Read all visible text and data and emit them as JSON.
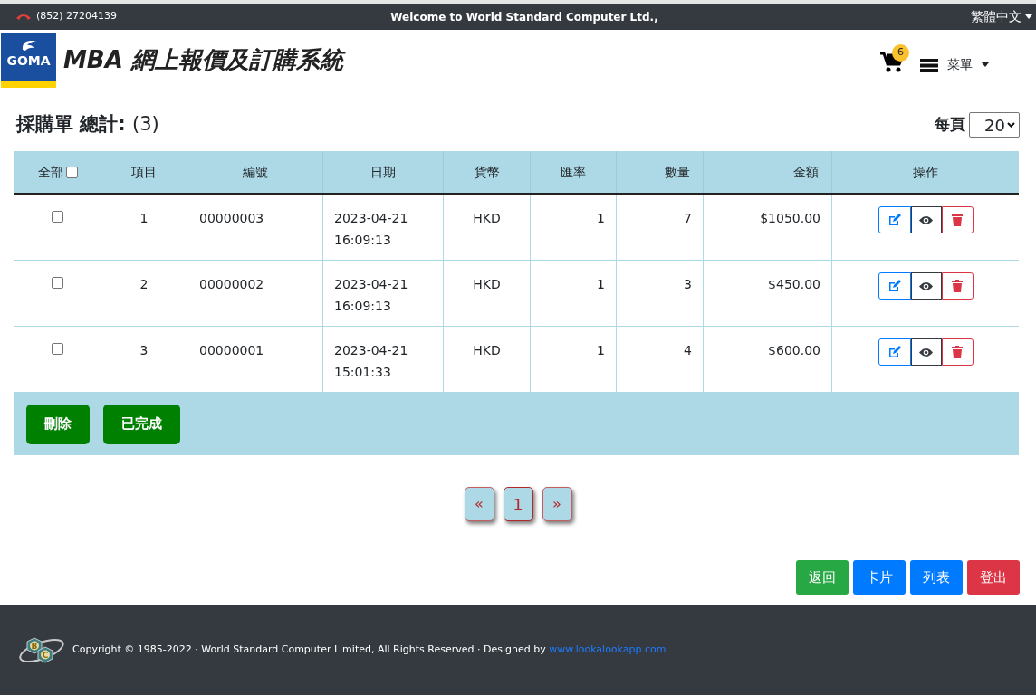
{
  "top_bar": {
    "phone": "(852) 27204139",
    "welcome": "Welcome to World Standard Computer Ltd.,",
    "language": "繁體中文"
  },
  "header": {
    "logo_text": "GOMA",
    "title": "MBA 網上報價及訂購系統",
    "cart_count": "6",
    "menu": "菜單"
  },
  "page": {
    "heading": "採購單 總計:",
    "total": "(3)",
    "per_page_label": "每頁",
    "per_page": "20"
  },
  "table": {
    "select_all_label": "全部",
    "select_all_checked": false,
    "columns": [
      "項目",
      "編號",
      "日期",
      "貨幣",
      "匯率",
      "數量",
      "金額",
      "操作"
    ],
    "rows": [
      {
        "checked": false,
        "item": "1",
        "number": "00000003",
        "date": "2023-04-21",
        "time": "16:09:13",
        "currency": "HKD",
        "rate": "1",
        "qty": "7",
        "amount": "$1050.00"
      },
      {
        "checked": false,
        "item": "2",
        "number": "00000002",
        "date": "2023-04-21",
        "time": "16:09:13",
        "currency": "HKD",
        "rate": "1",
        "qty": "3",
        "amount": "$450.00"
      },
      {
        "checked": false,
        "item": "3",
        "number": "00000001",
        "date": "2023-04-21",
        "time": "15:01:33",
        "currency": "HKD",
        "rate": "1",
        "qty": "4",
        "amount": "$600.00"
      }
    ],
    "footer_buttons": [
      "刪除",
      "已完成"
    ]
  },
  "pagination": [
    {
      "label": "«",
      "selected": false
    },
    {
      "label": "1",
      "selected": true
    },
    {
      "label": "»",
      "selected": false
    }
  ],
  "actions": [
    {
      "label": "返回",
      "color": "#28a745"
    },
    {
      "label": "卡片",
      "color": "#007bff"
    },
    {
      "label": "列表",
      "color": "#007bff"
    },
    {
      "label": "登出",
      "color": "#dc3545"
    }
  ],
  "footer": {
    "logo_letters": [
      "B",
      "C"
    ],
    "copyright": "Copyright © 1985-2022 · World Standard Computer Limited, All Rights Reserved · Designed by",
    "link": "www.lookalookapp.com"
  }
}
